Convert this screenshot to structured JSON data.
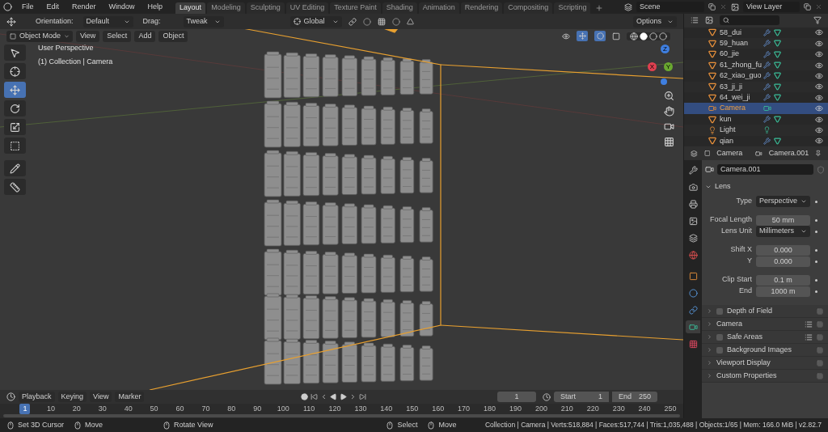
{
  "menu": [
    "File",
    "Edit",
    "Render",
    "Window",
    "Help"
  ],
  "workspaces": [
    {
      "label": "Layout",
      "selected": true
    },
    {
      "label": "Modeling",
      "selected": false
    },
    {
      "label": "Sculpting",
      "selected": false
    },
    {
      "label": "UV Editing",
      "selected": false
    },
    {
      "label": "Texture Paint",
      "selected": false
    },
    {
      "label": "Shading",
      "selected": false
    },
    {
      "label": "Animation",
      "selected": false
    },
    {
      "label": "Rendering",
      "selected": false
    },
    {
      "label": "Compositing",
      "selected": false
    },
    {
      "label": "Scripting",
      "selected": false
    }
  ],
  "scene": "Scene",
  "view_layer": "View Layer",
  "tool_settings": {
    "orientation_label": "Orientation:",
    "orientation": "Default",
    "drag_label": "Drag:",
    "drag": "Tweak",
    "transform": "Global",
    "options": "Options"
  },
  "viewport_header": {
    "mode": "Object Mode",
    "menus": [
      "View",
      "Select",
      "Add",
      "Object"
    ]
  },
  "viewport": {
    "overlay": [
      "User Perspective",
      "(1) Collection | Camera"
    ],
    "axes": [
      "X",
      "Y",
      "Z"
    ],
    "tools": [
      {
        "kind": "select",
        "selected": false
      },
      {
        "kind": "cursor",
        "selected": false
      },
      {
        "kind": "move",
        "selected": true
      },
      {
        "kind": "rotate",
        "selected": false
      },
      {
        "kind": "scale",
        "selected": false
      },
      {
        "kind": "transform",
        "selected": false
      },
      {
        "kind": "annotate",
        "selected": false
      },
      {
        "kind": "measure",
        "selected": false
      }
    ]
  },
  "outliner": {
    "items": [
      {
        "name": "58_dui",
        "kind": "mesh",
        "selected": false
      },
      {
        "name": "59_huan",
        "kind": "mesh",
        "selected": false
      },
      {
        "name": "60_jie",
        "kind": "mesh",
        "selected": false
      },
      {
        "name": "61_zhong_fu",
        "kind": "mesh",
        "selected": false
      },
      {
        "name": "62_xiao_guo",
        "kind": "mesh",
        "selected": false
      },
      {
        "name": "63_ji_ji",
        "kind": "mesh",
        "selected": false
      },
      {
        "name": "64_wei_ji",
        "kind": "mesh",
        "selected": false
      },
      {
        "name": "Camera",
        "kind": "camera",
        "selected": true
      },
      {
        "name": "kun",
        "kind": "mesh",
        "selected": false
      },
      {
        "name": "Light",
        "kind": "light",
        "selected": false
      },
      {
        "name": "qian",
        "kind": "mesh",
        "selected": false
      }
    ]
  },
  "properties": {
    "object": "Camera",
    "data": "Camera.001",
    "datablock": "Camera.001",
    "tabs": [
      {
        "kind": "tool",
        "selected": false
      },
      {
        "kind": "render",
        "selected": false
      },
      {
        "kind": "output",
        "selected": false
      },
      {
        "kind": "view_layer",
        "selected": false
      },
      {
        "kind": "scene",
        "selected": false
      },
      {
        "kind": "world",
        "selected": false
      },
      {
        "kind": "object",
        "selected": false
      },
      {
        "kind": "physics",
        "selected": false
      },
      {
        "kind": "constraints",
        "selected": false
      },
      {
        "kind": "data",
        "selected": true
      },
      {
        "kind": "texture",
        "selected": false
      }
    ],
    "panel": "Lens",
    "fields": [
      {
        "label": "Type",
        "value": "Perspective",
        "kind": "dropdown"
      },
      {
        "label": "Focal Length",
        "value": "50 mm",
        "kind": "number"
      },
      {
        "label": "Lens Unit",
        "value": "Millimeters",
        "kind": "dropdown"
      },
      {
        "label": "Shift X",
        "value": "0.000",
        "kind": "number"
      },
      {
        "label": "Y",
        "value": "0.000",
        "kind": "number"
      },
      {
        "label": "Clip Start",
        "value": "0.1 m",
        "kind": "number"
      },
      {
        "label": "End",
        "value": "1000 m",
        "kind": "number"
      }
    ],
    "subpanels": [
      {
        "label": "Depth of Field",
        "checked": false,
        "presets": false
      },
      {
        "label": "Camera",
        "presets": true
      },
      {
        "label": "Safe Areas",
        "checked": false,
        "presets": true
      },
      {
        "label": "Background Images",
        "checked": false,
        "presets": false
      },
      {
        "label": "Viewport Display",
        "presets": false
      },
      {
        "label": "Custom Properties",
        "presets": false
      }
    ]
  },
  "timeline": {
    "menus": [
      "Playback",
      "Keying",
      "View",
      "Marker"
    ],
    "current_frame": "1",
    "start_label": "Start",
    "start": "1",
    "end_label": "End",
    "end": "250",
    "ruler": [
      {
        "label": "1",
        "selected": true
      },
      {
        "label": "10",
        "selected": false
      },
      {
        "label": "20",
        "selected": false
      },
      {
        "label": "30",
        "selected": false
      },
      {
        "label": "40",
        "selected": false
      },
      {
        "label": "50",
        "selected": false
      },
      {
        "label": "60",
        "selected": false
      },
      {
        "label": "70",
        "selected": false
      },
      {
        "label": "80",
        "selected": false
      },
      {
        "label": "90",
        "selected": false
      },
      {
        "label": "100",
        "selected": false
      },
      {
        "label": "110",
        "selected": false
      },
      {
        "label": "120",
        "selected": false
      },
      {
        "label": "130",
        "selected": false
      },
      {
        "label": "140",
        "selected": false
      },
      {
        "label": "150",
        "selected": false
      },
      {
        "label": "160",
        "selected": false
      },
      {
        "label": "170",
        "selected": false
      },
      {
        "label": "180",
        "selected": false
      },
      {
        "label": "190",
        "selected": false
      },
      {
        "label": "200",
        "selected": false
      },
      {
        "label": "210",
        "selected": false
      },
      {
        "label": "220",
        "selected": false
      },
      {
        "label": "230",
        "selected": false
      },
      {
        "label": "240",
        "selected": false
      },
      {
        "label": "250",
        "selected": false
      }
    ]
  },
  "status_bar": {
    "hints": [
      "Set 3D Cursor",
      "Move",
      "Rotate View",
      "Select",
      "Move"
    ],
    "info": "Collection | Camera | Verts:518,884 | Faces:517,744 | Tris:1,035,488 | Objects:1/65 | Mem: 166.0 MiB | v2.82.7"
  }
}
